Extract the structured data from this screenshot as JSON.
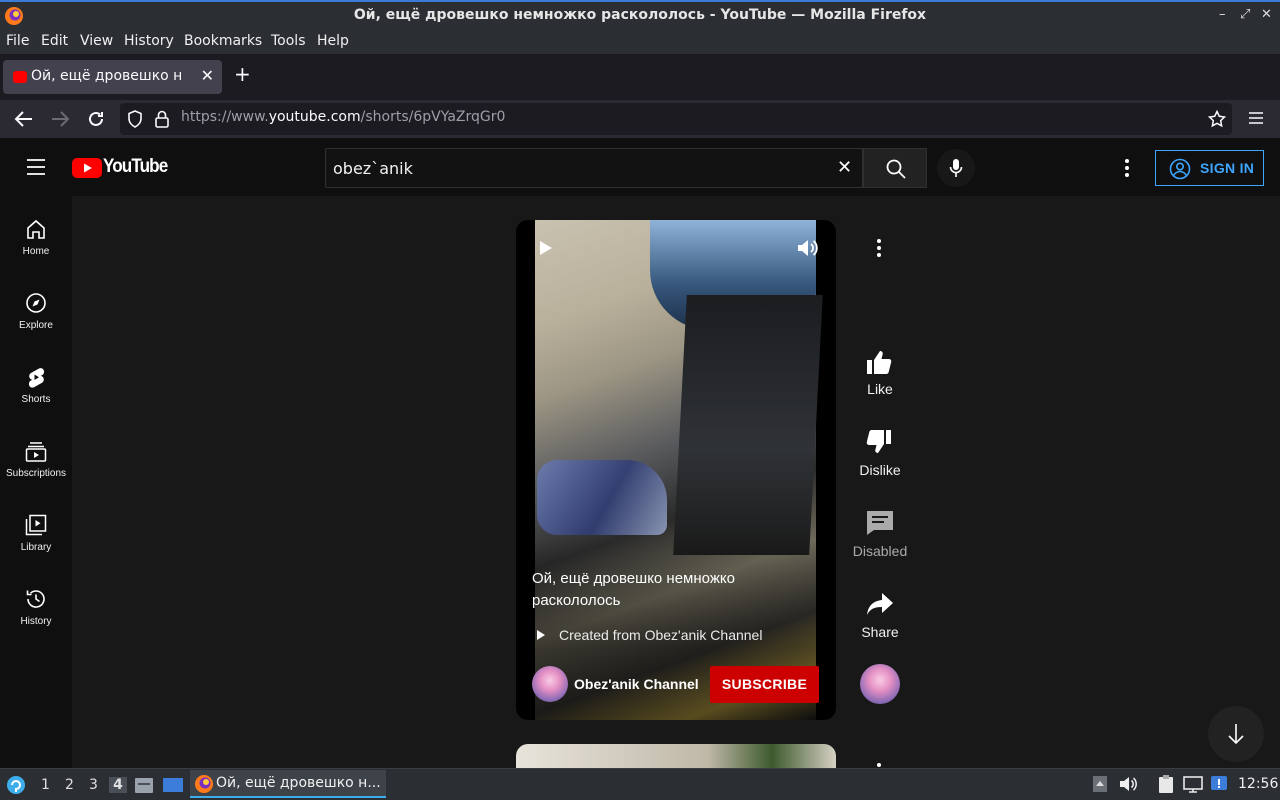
{
  "window": {
    "title": "Ой, ещё дровешко немножко раскололось - YouTube — Mozilla Firefox",
    "controls": [
      "–",
      "⤢",
      "✕"
    ]
  },
  "menu": [
    "File",
    "Edit",
    "View",
    "History",
    "Bookmarks",
    "Tools",
    "Help"
  ],
  "tab": {
    "label": "Ой, ещё дровешко немножко раскололось",
    "close": "✕",
    "new_tab": "+"
  },
  "url": {
    "scheme": "https://www.",
    "domain": "youtube.com",
    "path": "/shorts/6pVYaZrqGr0"
  },
  "youtube": {
    "logo_text": "YouTube",
    "search": {
      "value": "obez`anik",
      "clear": "✕"
    },
    "sign_in": "SIGN IN",
    "sidebar": [
      {
        "id": "home",
        "label": "Home"
      },
      {
        "id": "explore",
        "label": "Explore"
      },
      {
        "id": "shorts",
        "label": "Shorts"
      },
      {
        "id": "subscriptions",
        "label": "Subscriptions"
      },
      {
        "id": "library",
        "label": "Library"
      },
      {
        "id": "history",
        "label": "History"
      }
    ],
    "short": {
      "title": "Ой, ещё дровешко немножко раскололось",
      "created_prefix": "Created from ",
      "created_channel": "Obez'anik Channel",
      "channel_name": "Obez'anik Channel",
      "subscribe": "SUBSCRIBE"
    },
    "actions": {
      "like": "Like",
      "dislike": "Dislike",
      "comments": "Disabled",
      "share": "Share"
    }
  },
  "taskbar": {
    "workspaces": [
      "1",
      "2",
      "3",
      "4"
    ],
    "active_task": "Ой, ещё дровешко н...",
    "clock": "12:56"
  },
  "colors": {
    "accent_red": "#cc0000",
    "signin_blue": "#3ea6ff",
    "bg": "#0f0f0f",
    "main_bg": "#181818"
  }
}
